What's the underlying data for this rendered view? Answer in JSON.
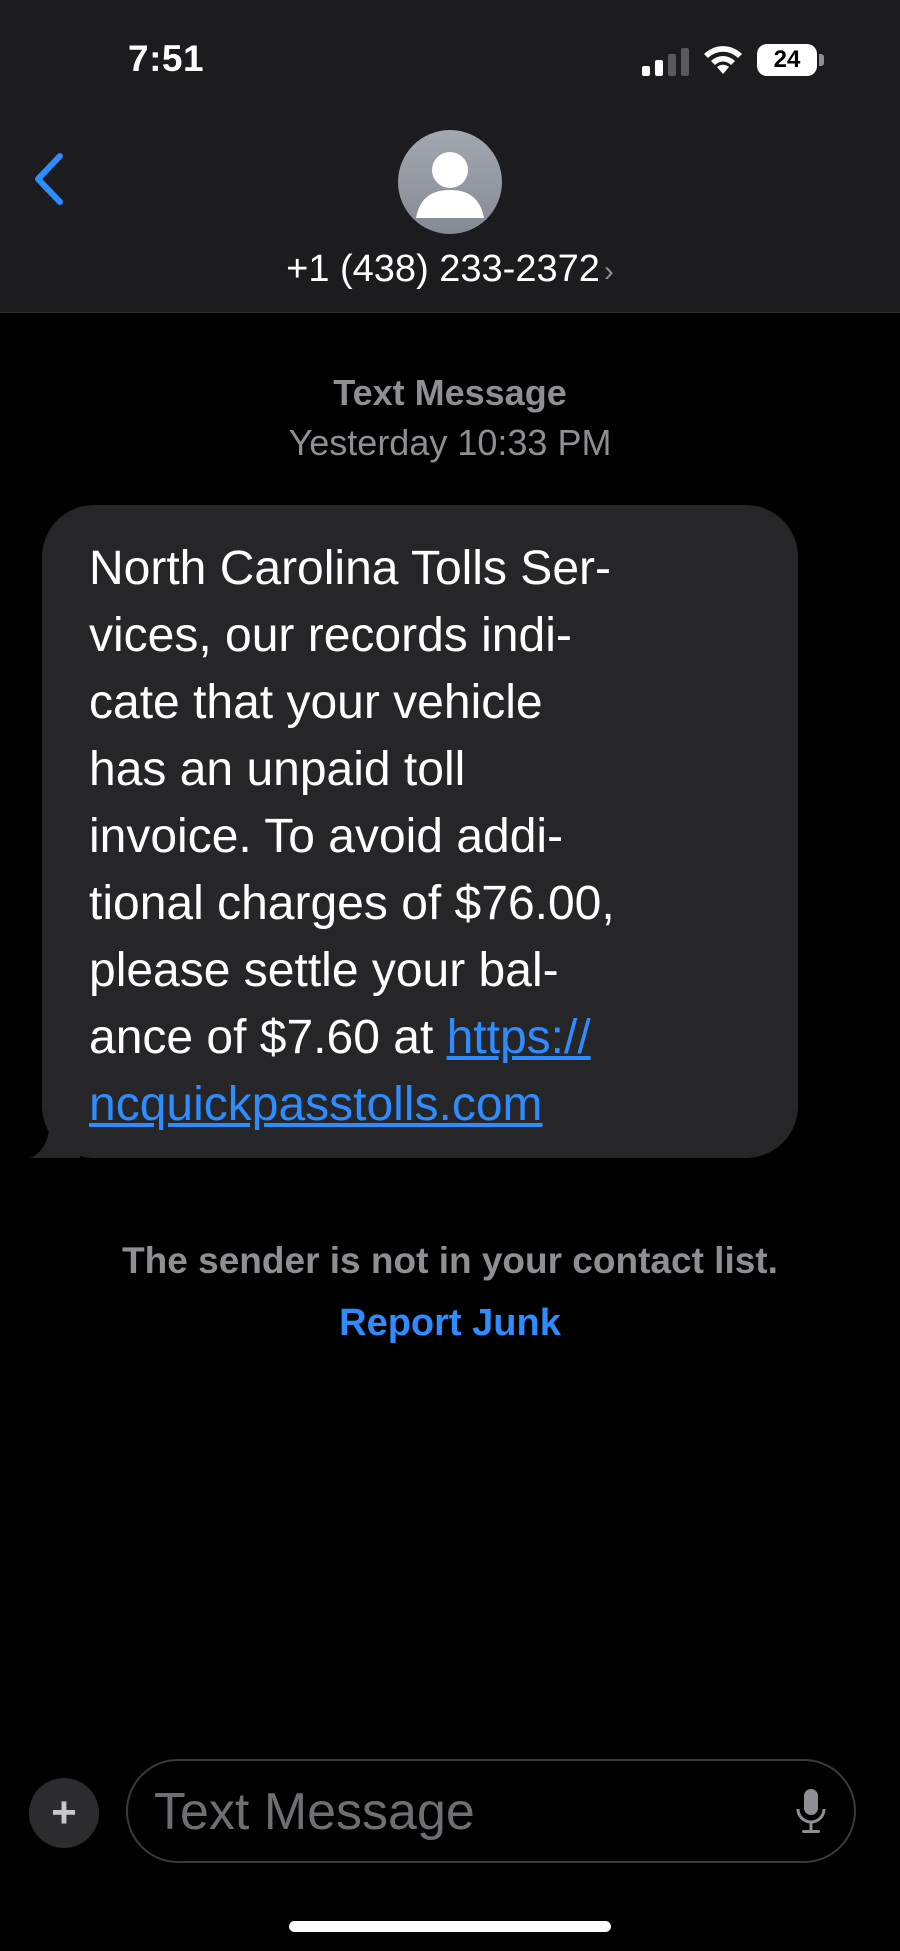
{
  "status_bar": {
    "time": "7:51",
    "battery": "24"
  },
  "header": {
    "contact": "+1 (438) 233-2372",
    "chevron": "›"
  },
  "conversation": {
    "service": "Text Message",
    "timestamp": "Yesterday 10:33 PM"
  },
  "message": {
    "lines": [
      "North Carolina Tolls Ser-",
      "vices, our records indi-",
      "cate that your vehicle",
      "has an unpaid toll",
      "invoice. To avoid addi-",
      "tional charges of $76.00,",
      "please settle your bal-"
    ],
    "line8_prefix": "ance of $7.60 at ",
    "link_part1": "https://",
    "link_part2": "ncquickpasstolls.com"
  },
  "notice": {
    "text": "The sender is not in your contact list.",
    "report_label": "Report Junk"
  },
  "composer": {
    "plus": "+",
    "placeholder": "Text Message"
  },
  "colors": {
    "accent": "#2d8cff",
    "bubble": "#262628",
    "header_bg": "#1c1c1e",
    "muted_text": "#8e8e93"
  },
  "icons": [
    "signal-icon",
    "wifi-icon",
    "battery-icon",
    "back-chevron-icon",
    "contact-avatar-icon",
    "chevron-right-icon",
    "plus-icon",
    "microphone-icon"
  ]
}
